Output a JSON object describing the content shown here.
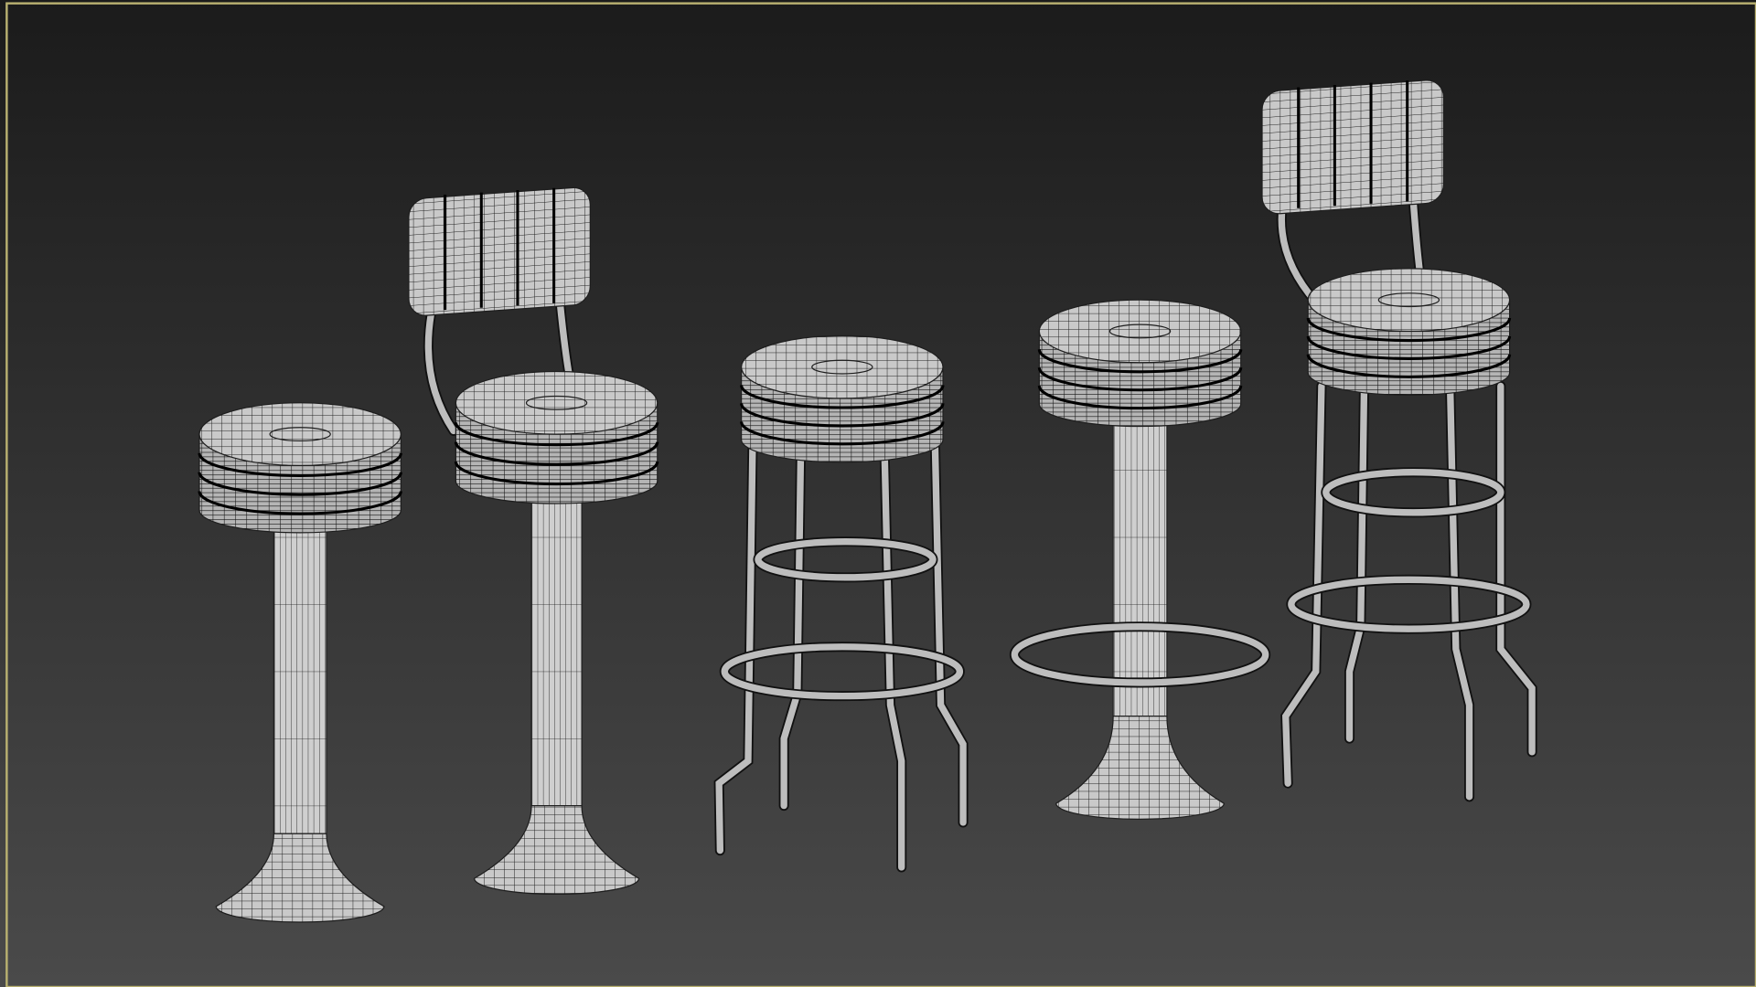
{
  "viewport": {
    "mode": "wireframe-shaded",
    "background_top": "#1b1b1b",
    "background_bottom": "#4a4a4a",
    "active_border_color": "#b8b070",
    "mesh_fill": "#c9c9c9",
    "wire_color": "#1e1e1e"
  },
  "scene": {
    "objects": [
      {
        "type": "pedestal-stool"
      },
      {
        "type": "pedestal-stool-with-back"
      },
      {
        "type": "four-leg-stool"
      },
      {
        "type": "pedestal-stool-with-footring"
      },
      {
        "type": "four-leg-stool-with-back"
      }
    ]
  }
}
